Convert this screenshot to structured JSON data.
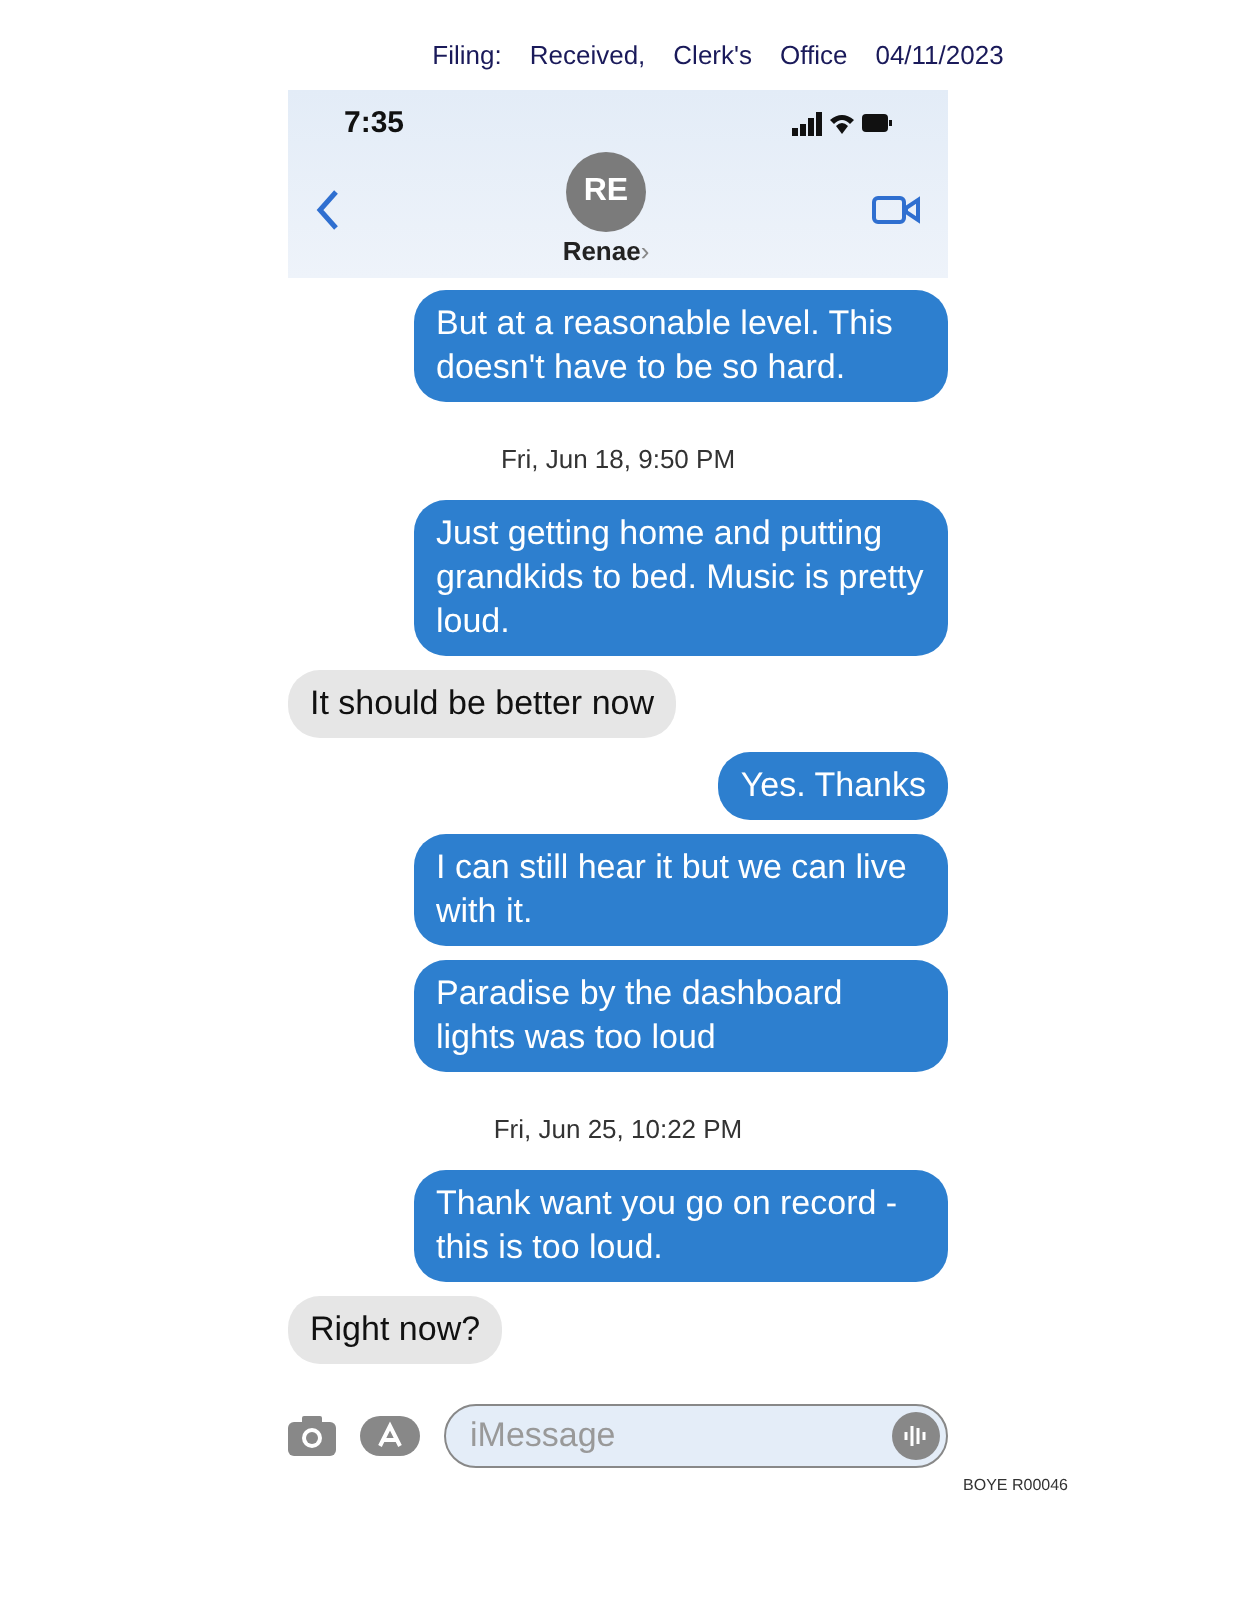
{
  "filing_stamp": [
    "Filing:",
    "Received,",
    "Clerk's",
    "Office",
    "04/11/2023"
  ],
  "status_bar": {
    "time": "7:35"
  },
  "contact": {
    "initials": "RE",
    "name": "Renae",
    "chevron": "›"
  },
  "messages": [
    {
      "kind": "sent",
      "text": "But at a reasonable level. This doesn't have to be so hard."
    },
    {
      "kind": "timestamp",
      "text": "Fri, Jun 18, 9:50 PM"
    },
    {
      "kind": "sent",
      "text": "Just getting home and putting grandkids to bed. Music is pretty loud."
    },
    {
      "kind": "received",
      "text": "It should be better now"
    },
    {
      "kind": "sent",
      "text": "Yes. Thanks"
    },
    {
      "kind": "sent",
      "text": "I can still hear it but we can live with it."
    },
    {
      "kind": "sent",
      "text": "Paradise by the dashboard lights was too loud"
    },
    {
      "kind": "timestamp",
      "text": "Fri, Jun 25, 10:22 PM"
    },
    {
      "kind": "sent",
      "text": "Thank want you go on record - this is too loud."
    },
    {
      "kind": "received",
      "text": "Right now?"
    }
  ],
  "composer": {
    "placeholder": "iMessage"
  },
  "bates_number": "BOYE R00046"
}
